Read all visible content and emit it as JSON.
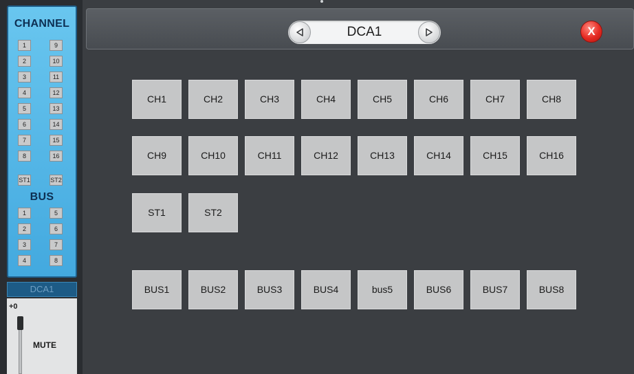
{
  "sidebar": {
    "channel_title": "CHANNEL",
    "channel_buttons": [
      "1",
      "2",
      "3",
      "4",
      "5",
      "6",
      "7",
      "8",
      "9",
      "10",
      "11",
      "12",
      "13",
      "14",
      "15",
      "16"
    ],
    "stereo_buttons": [
      "ST1",
      "ST2"
    ],
    "bus_title": "BUS",
    "bus_buttons": [
      "1",
      "2",
      "3",
      "4",
      "5",
      "6",
      "7",
      "8"
    ],
    "dca_label": "DCA1",
    "fader_level": "+0",
    "mute_label": "MUTE"
  },
  "header": {
    "title": "DCA1",
    "prev_icon": "triangle-left-icon",
    "next_icon": "triangle-right-icon",
    "close_label": "X",
    "close_color": "#e52a22"
  },
  "grid": {
    "channels": [
      "CH1",
      "CH2",
      "CH3",
      "CH4",
      "CH5",
      "CH6",
      "CH7",
      "CH8",
      "CH9",
      "CH10",
      "CH11",
      "CH12",
      "CH13",
      "CH14",
      "CH15",
      "CH16"
    ],
    "stereo": [
      "ST1",
      "ST2"
    ],
    "buses": [
      "BUS1",
      "BUS2",
      "BUS3",
      "BUS4",
      "bus5",
      "BUS6",
      "BUS7",
      "BUS8"
    ]
  },
  "colors": {
    "panel_blue": "#43a9df",
    "button_gray": "#c5c6c7",
    "background": "#3b3e42"
  }
}
